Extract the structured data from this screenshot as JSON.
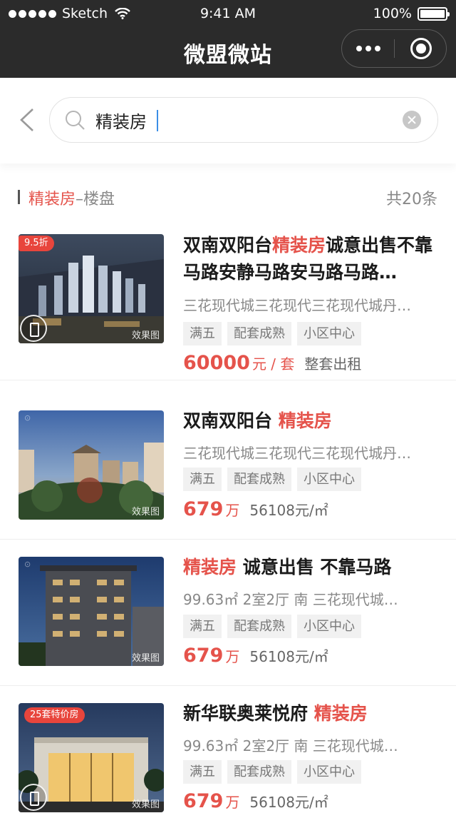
{
  "status_bar": {
    "carrier": "Sketch",
    "time": "9:41 AM",
    "battery": "100%"
  },
  "nav": {
    "title": "微盟微站"
  },
  "search": {
    "query": "精装房"
  },
  "section": {
    "keyword": "精装房",
    "suffix": "–楼盘",
    "count": "共20条"
  },
  "listings": [
    {
      "tag": "9.5折",
      "thumb_label": "效果图",
      "title_plain": "双南双阳台",
      "title_hl": "精装房",
      "title_rest": "诚意出售不靠马路安静马路安马路马路…",
      "subtitle": "三花现代城三花现代三花现代城丹…",
      "tags": [
        "满五",
        "配套成熟",
        "小区中心"
      ],
      "price": "60000",
      "price_unit": "元 / 套",
      "price_extra": "整套出租"
    },
    {
      "thumb_label": "效果图",
      "title_plain": "双南双阳台 ",
      "title_hl": "精装房",
      "subtitle": "三花现代城三花现代三花现代城丹…",
      "tags": [
        "满五",
        "配套成熟",
        "小区中心"
      ],
      "price": "679",
      "price_unit": "万",
      "price_extra": "56108元/㎡"
    },
    {
      "thumb_label": "效果图",
      "title_hl": "精装房",
      "title_rest": " 诚意出售 不靠马路",
      "subtitle": "99.63㎡  2室2厅  南   三花现代城…",
      "tags": [
        "满五",
        "配套成熟",
        "小区中心"
      ],
      "price": "679",
      "price_unit": "万",
      "price_extra": "56108元/㎡"
    },
    {
      "tag": "25套特价房",
      "thumb_label": "效果图",
      "title_plain": "新华联奥莱悦府  ",
      "title_hl": "精装房",
      "subtitle": "99.63㎡  2室2厅  南   三花现代城…",
      "tags": [
        "满五",
        "配套成熟",
        "小区中心"
      ],
      "price": "679",
      "price_unit": "万",
      "price_extra": "56108元/㎡"
    }
  ]
}
